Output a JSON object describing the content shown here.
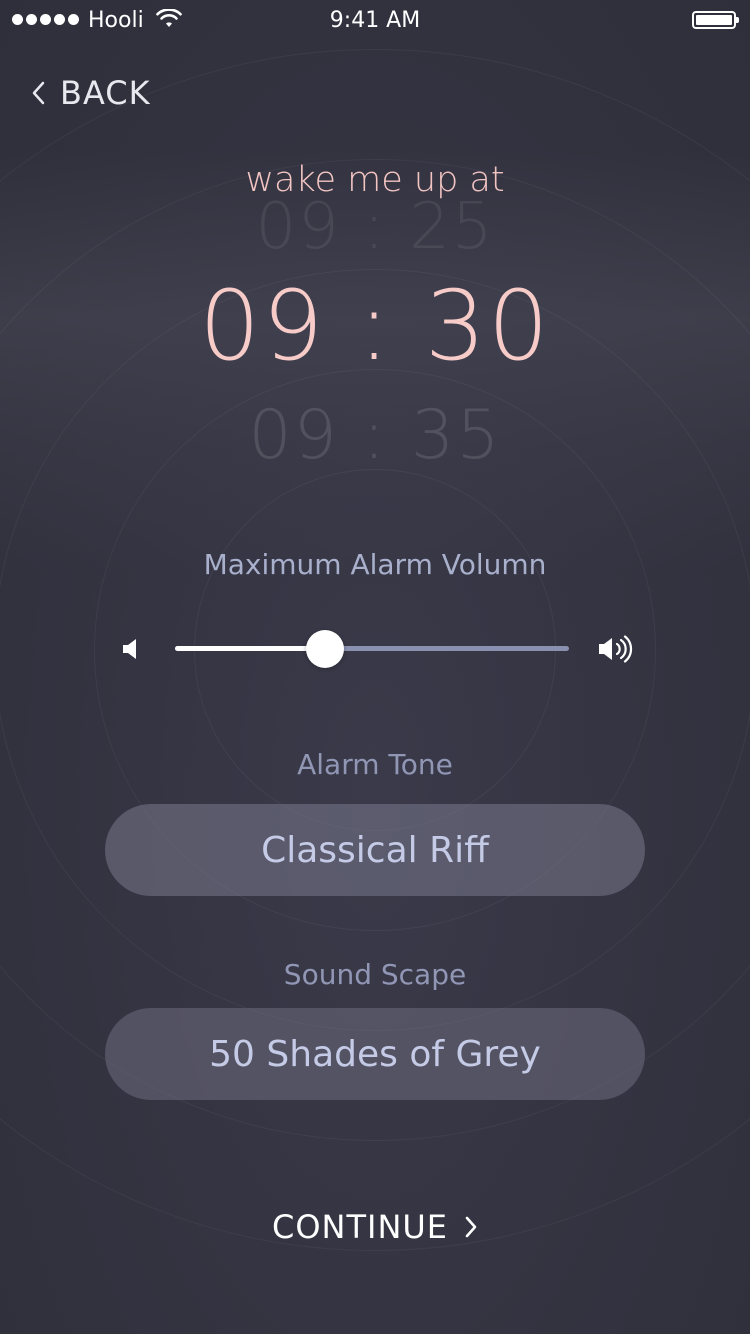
{
  "status_bar": {
    "carrier": "Hooli",
    "time": "9:41 AM",
    "signal_icon": "signal-dots-icon",
    "wifi_icon": "wifi-icon",
    "battery_icon": "battery-icon"
  },
  "nav": {
    "back_label": "BACK",
    "back_icon": "chevron-left-icon"
  },
  "alarm": {
    "heading": "wake me up at",
    "time_previous": "09 : 25",
    "time_current": "09 : 30",
    "time_next": "09 : 35"
  },
  "volume": {
    "label": "Maximum Alarm Volumn",
    "level": 0.38,
    "low_icon": "speaker-low-icon",
    "high_icon": "speaker-high-icon"
  },
  "alarm_tone": {
    "label": "Alarm Tone",
    "value": "Classical Riff"
  },
  "sound_scape": {
    "label": "Sound Scape",
    "value": "50 Shades of Grey"
  },
  "footer": {
    "continue_label": "CONTINUE",
    "continue_icon": "chevron-right-icon"
  },
  "colors": {
    "accent_pink": "#f7cbc8",
    "label_blue": "#a9b0cc",
    "background": "#343442"
  }
}
